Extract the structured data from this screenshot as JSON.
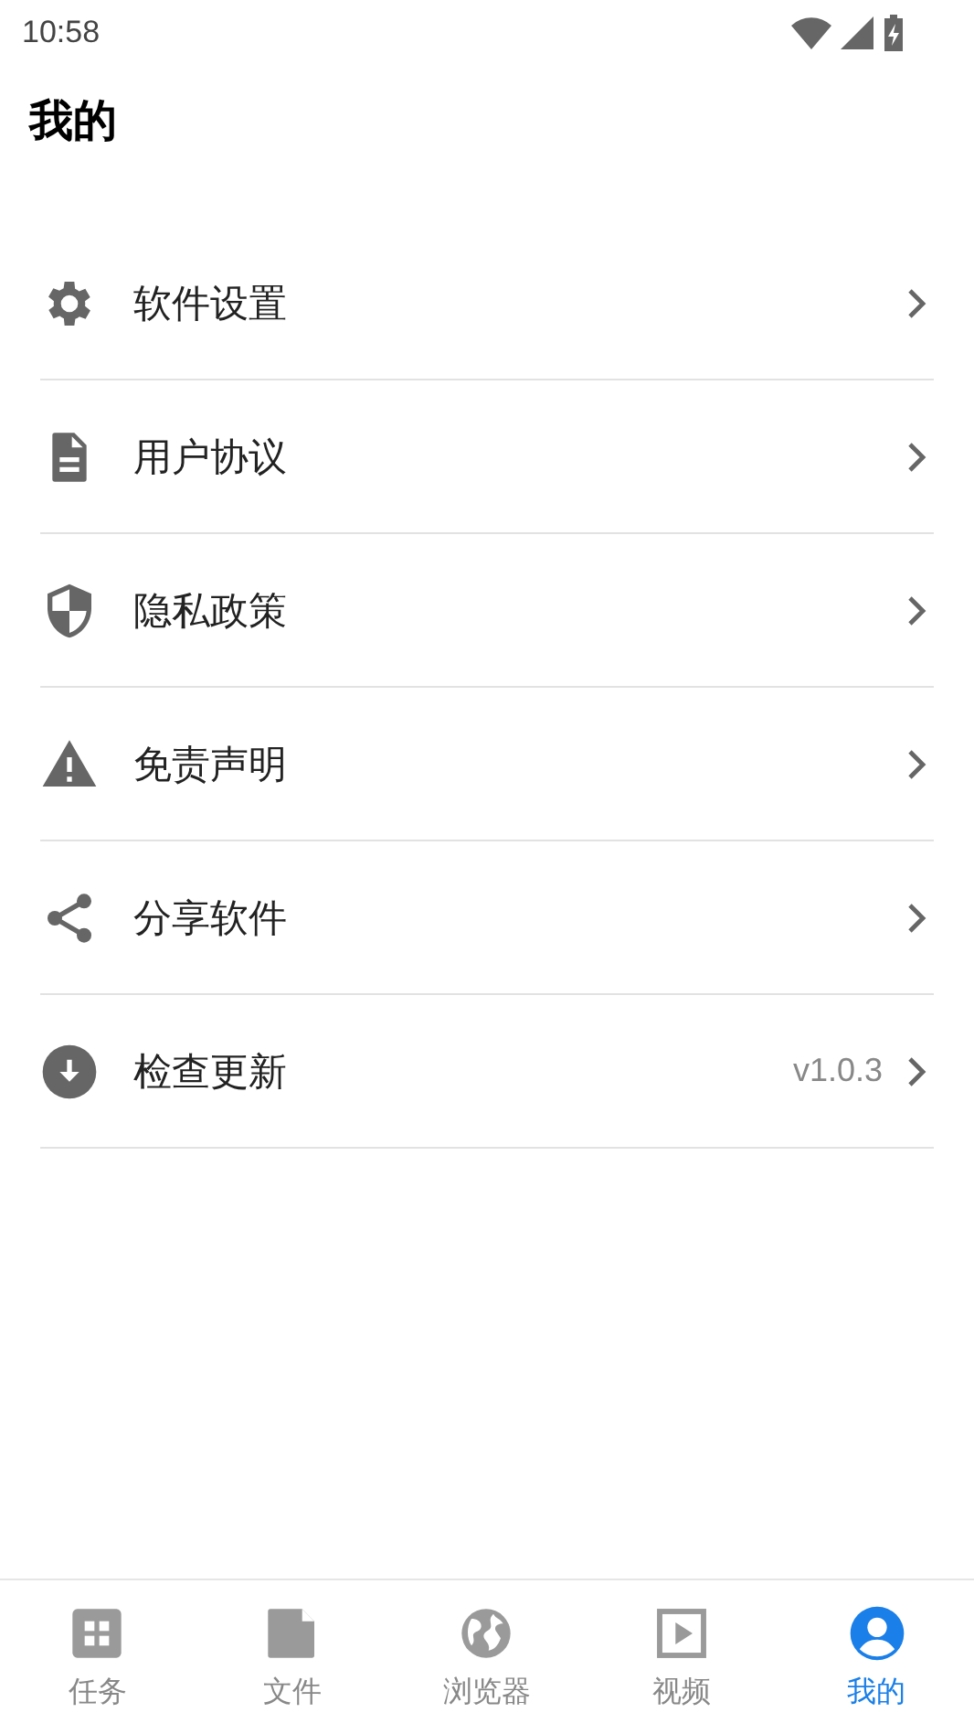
{
  "status_bar": {
    "time": "10:58"
  },
  "header": {
    "title": "我的"
  },
  "menu": [
    {
      "label": "软件设置"
    },
    {
      "label": "用户协议"
    },
    {
      "label": "隐私政策"
    },
    {
      "label": "免责声明"
    },
    {
      "label": "分享软件"
    },
    {
      "label": "检查更新",
      "value": "v1.0.3"
    }
  ],
  "bottom_nav": [
    {
      "label": "任务",
      "selected": false
    },
    {
      "label": "文件",
      "selected": false
    },
    {
      "label": "浏览器",
      "selected": false
    },
    {
      "label": "视频",
      "selected": false
    },
    {
      "label": "我的",
      "selected": true
    }
  ]
}
